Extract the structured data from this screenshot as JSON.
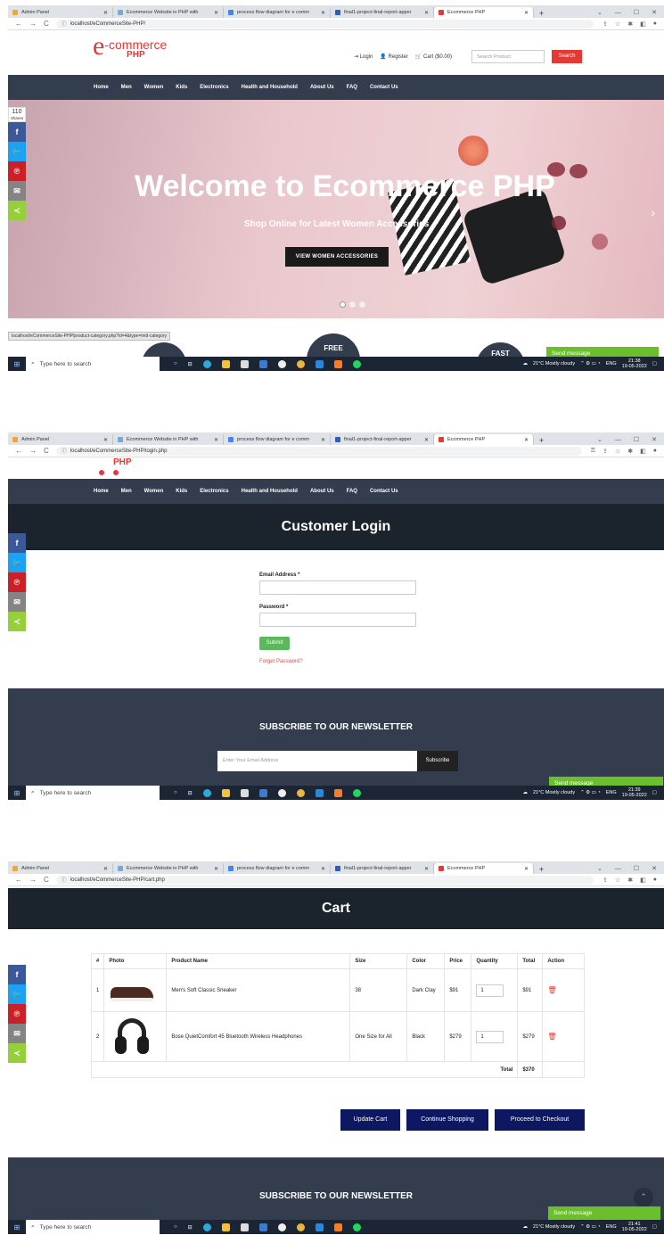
{
  "browser": {
    "tabs": [
      {
        "label": "Admin Panel",
        "color": "#f4a53a"
      },
      {
        "label": "Ecommerce Website in PHP with",
        "color": "#7aa7d9"
      },
      {
        "label": "process flow diagram for e comm",
        "color": "#4285f4"
      },
      {
        "label": "final1-project-final-report-apper",
        "color": "#2c5fb5"
      },
      {
        "label": "Ecommerce PHP",
        "color": "#e53935"
      }
    ],
    "urls": [
      "localhost/eCommerceSite-PHP/",
      "localhost/eCommerceSite-PHP/login.php",
      "localhost/eCommerceSite-PHP/cart.php"
    ]
  },
  "taskbar": {
    "search_placeholder": "Type here to search",
    "weather": "21°C  Mostly cloudy",
    "lang": "ENG",
    "times": [
      "21:38",
      "21:39",
      "21:41"
    ],
    "date": "19-05-2022"
  },
  "share": {
    "count": "110",
    "label": "Shares"
  },
  "header": {
    "logo_text": "-commerce",
    "logo_sub": "PHP",
    "login": "Login",
    "register": "Register",
    "cart": "Cart ($0.00)",
    "search_placeholder": "Search Product",
    "search_button": "Search"
  },
  "nav": [
    "Home",
    "Men",
    "Women",
    "Kids",
    "Electronics",
    "Health and Household",
    "About Us",
    "FAQ",
    "Contact Us"
  ],
  "hero": {
    "title": "Welcome to Ecommerce PHP",
    "subtitle": "Shop Online for Latest Women Accessories",
    "cta": "VIEW WOMEN ACCESSORIES"
  },
  "status_url": "localhost/eCommerceSite-PHP/product-category.php?id=4&type=mid-category",
  "badges": [
    "FREE",
    "FAST"
  ],
  "chat": {
    "label": "Send message"
  },
  "login": {
    "title": "Customer Login",
    "email_label": "Email Address *",
    "password_label": "Password *",
    "submit": "Submit",
    "forgot": "Forget Password?"
  },
  "newsletter": {
    "title": "SUBSCRIBE TO OUR NEWSLETTER",
    "placeholder": "Enter Your Email Address",
    "button": "Subscribe"
  },
  "cart": {
    "title": "Cart",
    "headers": [
      "#",
      "Photo",
      "Product Name",
      "Size",
      "Color",
      "Price",
      "Quantity",
      "Total",
      "Action"
    ],
    "rows": [
      {
        "n": "1",
        "name": "Men's Soft Classic Sneaker",
        "size": "38",
        "color": "Dark Clay",
        "price": "$91",
        "qty": "1",
        "total": "$91"
      },
      {
        "n": "2",
        "name": "Bose QuietComfort 45 Bluetooth Wireless Headphones",
        "size": "One Size for All",
        "color": "Black",
        "price": "$279",
        "qty": "1",
        "total": "$279"
      }
    ],
    "total_label": "Total",
    "total_value": "$370",
    "buttons": [
      "Update Cart",
      "Continue Shopping",
      "Proceed to Checkout"
    ]
  },
  "colors": {
    "brand": "#e53935",
    "nav": "#333d4e",
    "pagehead": "#1b232d",
    "cart_button": "#0e1860",
    "chat": "#6cbf2c"
  }
}
